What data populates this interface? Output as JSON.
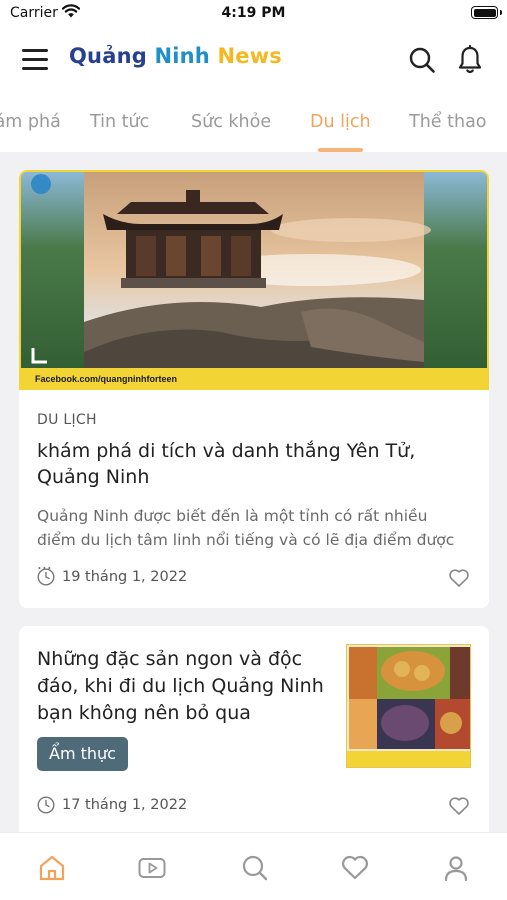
{
  "status_bar": {
    "carrier": "Carrier",
    "time": "4:19 PM"
  },
  "header": {
    "logo_part1": "Quảng",
    "logo_part2": "Ninh",
    "logo_part3": "News",
    "icons": [
      "menu-icon",
      "search-icon",
      "bell-icon"
    ]
  },
  "tabs": [
    {
      "label": "Khám phá",
      "active": false
    },
    {
      "label": "Tin tức",
      "active": false
    },
    {
      "label": "Sức khỏe",
      "active": false
    },
    {
      "label": "Du lịch",
      "active": true
    },
    {
      "label": "Thể thao",
      "active": false
    }
  ],
  "featured_article": {
    "image_caption": "Facebook.com/quangninhforteen",
    "category": "DU LỊCH",
    "title": "khám phá di tích và danh thắng Yên Tử, Quảng Ninh",
    "excerpt": "Quảng Ninh được biết đến là một tỉnh có rất nhiều điểm du lịch tâm linh nổi tiếng và có lẽ địa điểm được ...",
    "date": "19 tháng 1, 2022"
  },
  "second_article": {
    "title": "Những đặc sản ngon và độc đáo, khi đi du lịch Quảng Ninh bạn không nên bỏ qua",
    "category": "Ẩm thực",
    "date": "17 tháng 1, 2022"
  },
  "bottom_nav": [
    "home-icon",
    "video-icon",
    "search-icon",
    "heart-icon",
    "profile-icon"
  ],
  "colors": {
    "accent": "#f0a45b",
    "chip": "#4f6b7a",
    "logo_blue": "#27408f",
    "logo_cyan": "#1f8fca",
    "logo_yellow": "#f4b820"
  }
}
